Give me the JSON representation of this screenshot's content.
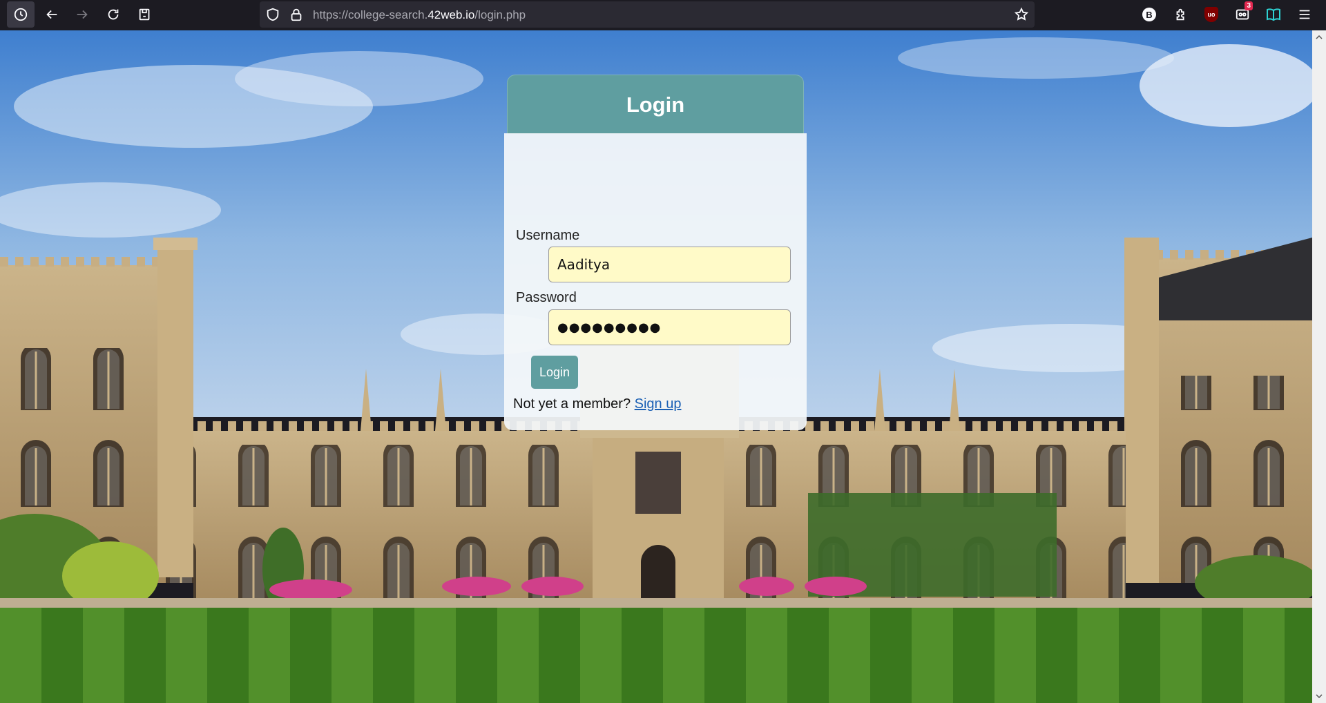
{
  "browser": {
    "url_prefix": "https://college-search.",
    "url_host": "42web.io",
    "url_path": "/login.php",
    "extensions": {
      "b_label": "B",
      "ublock_label": "uo",
      "badge_count": "3"
    },
    "icons": [
      "history-icon",
      "back-icon",
      "forward-icon",
      "reload-icon",
      "save-page-icon",
      "shield-icon",
      "lock-icon",
      "bookmark-star-icon",
      "puzzle-icon",
      "reader-icon",
      "menu-icon"
    ]
  },
  "login": {
    "title": "Login",
    "username_label": "Username",
    "username_value": "Aaditya",
    "password_label": "Password",
    "password_masked": "●●●●●●●●●",
    "button_label": "Login",
    "signup_prompt": "Not yet a member?",
    "signup_link": "Sign up"
  },
  "colors": {
    "header": "#5f9ea0",
    "button": "#5f9ea0",
    "input_bg": "#fffac8",
    "link": "#1a5fb4"
  }
}
